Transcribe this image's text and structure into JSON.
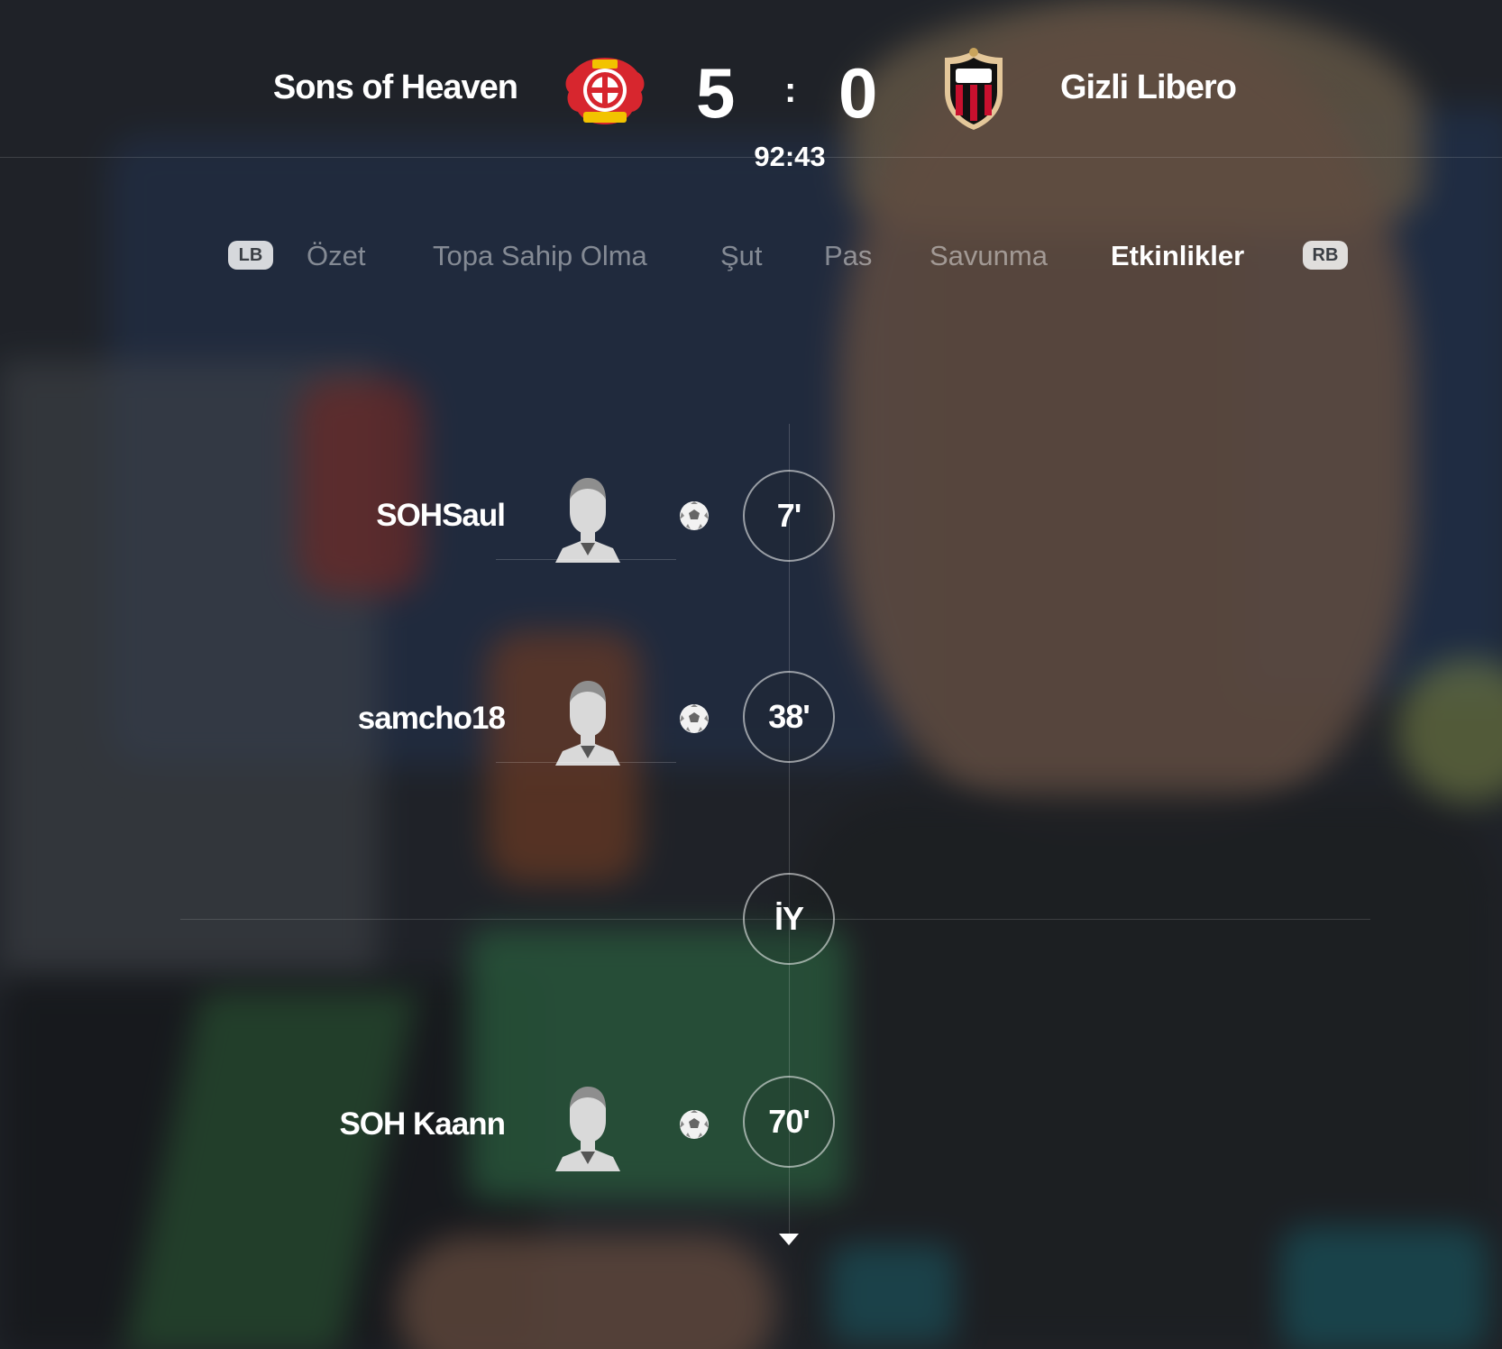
{
  "match": {
    "home_team": "Sons of Heaven",
    "away_team": "Gizli Libero",
    "home_score": "5",
    "score_separator": ":",
    "away_score": "0",
    "clock": "92:43"
  },
  "tabs": {
    "left_bumper": "LB",
    "right_bumper": "RB",
    "items": [
      {
        "label": "Özet",
        "active": false
      },
      {
        "label": "Topa Sahip Olma",
        "active": false
      },
      {
        "label": "Şut",
        "active": false
      },
      {
        "label": "Pas",
        "active": false
      },
      {
        "label": "Savunma",
        "active": false
      },
      {
        "label": "Etkinlikler",
        "active": true
      }
    ]
  },
  "events": [
    {
      "player": "SOHSaul",
      "minute": "7'",
      "type_icon": "soccer-ball-icon"
    },
    {
      "player": "samcho18",
      "minute": "38'",
      "type_icon": "soccer-ball-icon"
    },
    {
      "player": "SOH Kaann",
      "minute": "70'",
      "type_icon": "soccer-ball-icon"
    }
  ],
  "halftime_label": "İY",
  "colors": {
    "home_crest_red": "#d7262e",
    "away_crest_red": "#c8102e",
    "tab_inactive": "#8c8f94",
    "tab_active": "#ffffff"
  }
}
